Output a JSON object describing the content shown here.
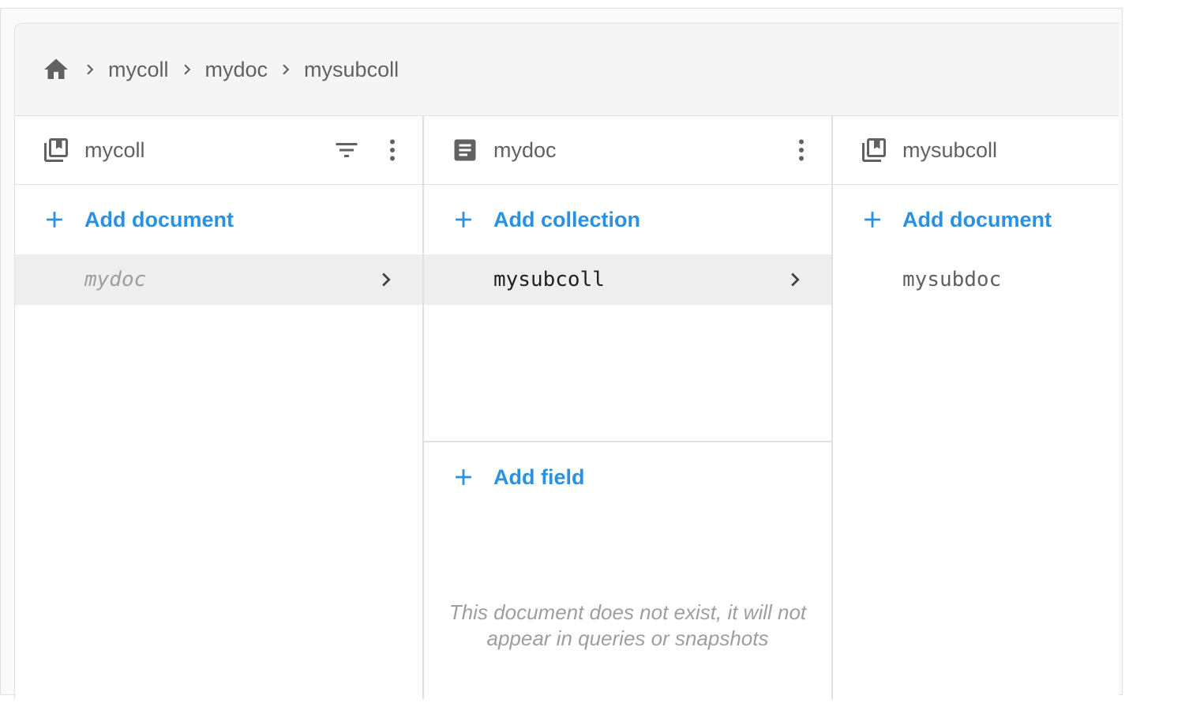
{
  "breadcrumb": {
    "items": [
      "mycoll",
      "mydoc",
      "mysubcoll"
    ]
  },
  "colors": {
    "accent": "#2a91e0",
    "text_secondary": "#616161",
    "selected_row": "#eeeeee",
    "border": "#e0e0e0"
  },
  "columns": [
    {
      "type": "collection",
      "icon": "collection-icon",
      "title": "mycoll",
      "add_label": "Add document",
      "items": [
        {
          "label": "mydoc",
          "selected": true,
          "italic": true
        }
      ]
    },
    {
      "type": "document",
      "icon": "document-icon",
      "title": "mydoc",
      "add_label": "Add collection",
      "items": [
        {
          "label": "mysubcoll",
          "selected": true
        }
      ],
      "add_field_label": "Add field",
      "missing_note": "This document does not exist, it will not appear in queries or snapshots"
    },
    {
      "type": "collection",
      "icon": "collection-icon",
      "title": "mysubcoll",
      "add_label": "Add document",
      "items": [
        {
          "label": "mysubdoc",
          "selected": false
        }
      ]
    }
  ]
}
